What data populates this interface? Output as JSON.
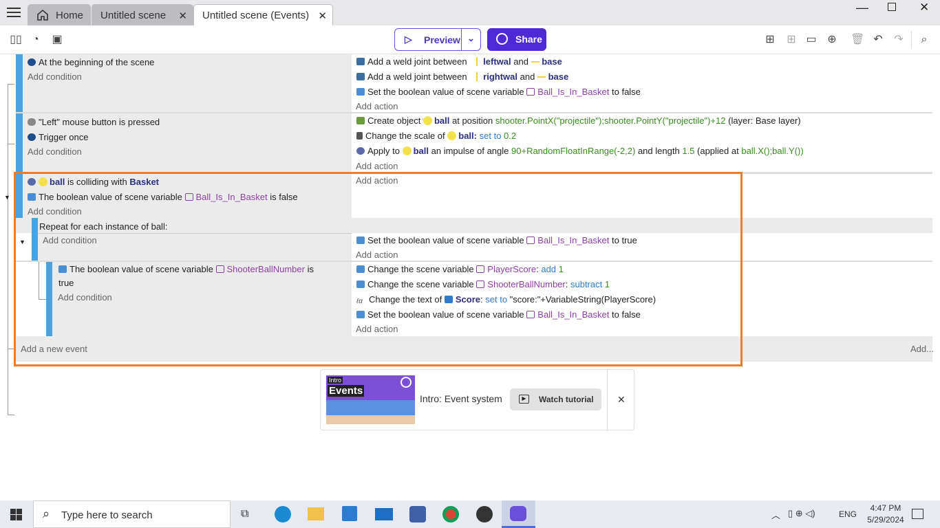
{
  "tabs": {
    "home": "Home",
    "scene": "Untitled scene",
    "events": "Untitled scene (Events)"
  },
  "toolbar": {
    "preview": "Preview",
    "share": "Share"
  },
  "events": [
    {
      "conditions": [
        "At the beginning of the scene"
      ],
      "add_condition": "Add condition",
      "actions": [
        {
          "t1": "Add a weld joint between",
          "o1": "leftwal",
          "and": "and",
          "o2": "base"
        },
        {
          "t1": "Add a weld joint between",
          "o1": "rightwal",
          "and": "and",
          "o2": "base"
        },
        {
          "t1": "Set the boolean value of scene variable",
          "v": "Ball_Is_In_Basket",
          "t2": "to false"
        }
      ],
      "add_action": "Add action"
    },
    {
      "conditions": [
        "\"Left\" mouse button is pressed",
        "Trigger once"
      ],
      "add_condition": "Add condition",
      "actions": [
        {
          "t1": "Create object",
          "o1": "ball",
          "t2": "at position",
          "p": "shooter.PointX(\"projectile\");shooter.PointY(\"projectile\")+12",
          "t3": "(layer:",
          "layer": "Base layer)"
        },
        {
          "t1": "Change the scale of",
          "o1": "ball:",
          "op": "set to",
          "n": "0.2"
        },
        {
          "t1": "Apply to",
          "o1": "ball",
          "t2": "an impulse of angle",
          "e1": "90+RandomFloatInRange(-2,2)",
          "t3": "and length",
          "n": "1.5",
          "t4": "(applied at",
          "e2": "ball.X();ball.Y())"
        }
      ],
      "add_action": "Add action"
    },
    {
      "c1o": "ball",
      "c1t": "is colliding with",
      "c1o2": "Basket",
      "c2t": "The boolean value of scene variable",
      "c2v": "Ball_Is_In_Basket",
      "c2t2": "is false",
      "add_condition": "Add condition",
      "add_action": "Add action",
      "repeat": "Repeat for each instance of ball:",
      "repeat_add_condition": "Add condition",
      "repeat_action": {
        "t1": "Set the boolean value of scene variable",
        "v": "Ball_Is_In_Basket",
        "t2": "to true"
      },
      "repeat_add_action": "Add action",
      "sub": {
        "ct": "The boolean value of scene variable",
        "cv": "ShooterBallNumber",
        "ct2": "is",
        "ct3": "true",
        "add_condition": "Add condition",
        "actions": [
          {
            "t1": "Change the scene variable",
            "v": "PlayerScore",
            "op": "add",
            "n": "1"
          },
          {
            "t1": "Change the scene variable",
            "v": "ShooterBallNumber",
            "op": "subtract",
            "n": "1"
          },
          {
            "t1": "Change the text of",
            "o1": "Score",
            "op": "set to",
            "e": "\"score:\"+VariableString(PlayerScore)"
          },
          {
            "t1": "Set the boolean value of scene variable",
            "v": "Ball_Is_In_Basket",
            "t2": "to false"
          }
        ],
        "add_action": "Add action"
      }
    }
  ],
  "add_new_event": "Add a new event",
  "add_more": "Add...",
  "tutorial": {
    "thumb_top": "Intro",
    "thumb_main": "Events",
    "title": "Intro: Event system",
    "button": "Watch tutorial"
  },
  "taskbar": {
    "search_placeholder": "Type here to search",
    "lang": "ENG",
    "time": "4:47 PM",
    "date": "5/29/2024"
  },
  "colors": {
    "accent": "#4d2ad6",
    "highlight": "#f47a20",
    "event_bar": "#4aa3df"
  }
}
